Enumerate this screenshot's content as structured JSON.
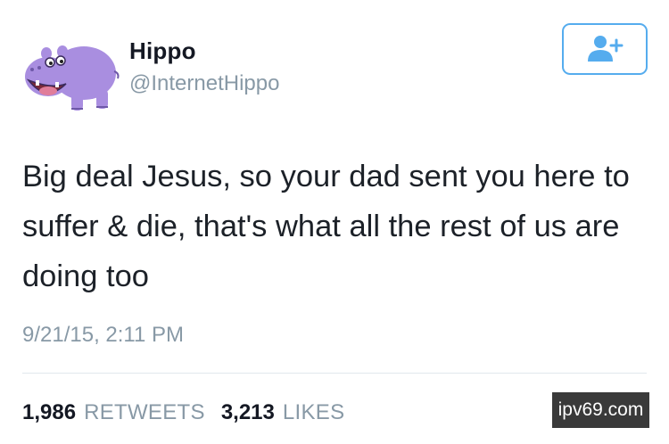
{
  "profile": {
    "display_name": "Hippo",
    "handle": "@InternetHippo",
    "avatar_icon": "hippo-icon"
  },
  "follow_button": {
    "icon": "add-user-icon",
    "color": "#55acee"
  },
  "tweet": {
    "text": "Big deal Jesus, so your dad sent you here to suffer & die, that's what all the rest of us are doing too",
    "timestamp": "9/21/15, 2:11 PM"
  },
  "stats": {
    "retweets_count": "1,986",
    "retweets_label": "RETWEETS",
    "likes_count": "3,213",
    "likes_label": "LIKES"
  },
  "watermark": {
    "text": "ipv69.com"
  },
  "colors": {
    "accent": "#55acee",
    "muted_text": "#8899a6",
    "hippo_purple": "#a98ee0"
  }
}
